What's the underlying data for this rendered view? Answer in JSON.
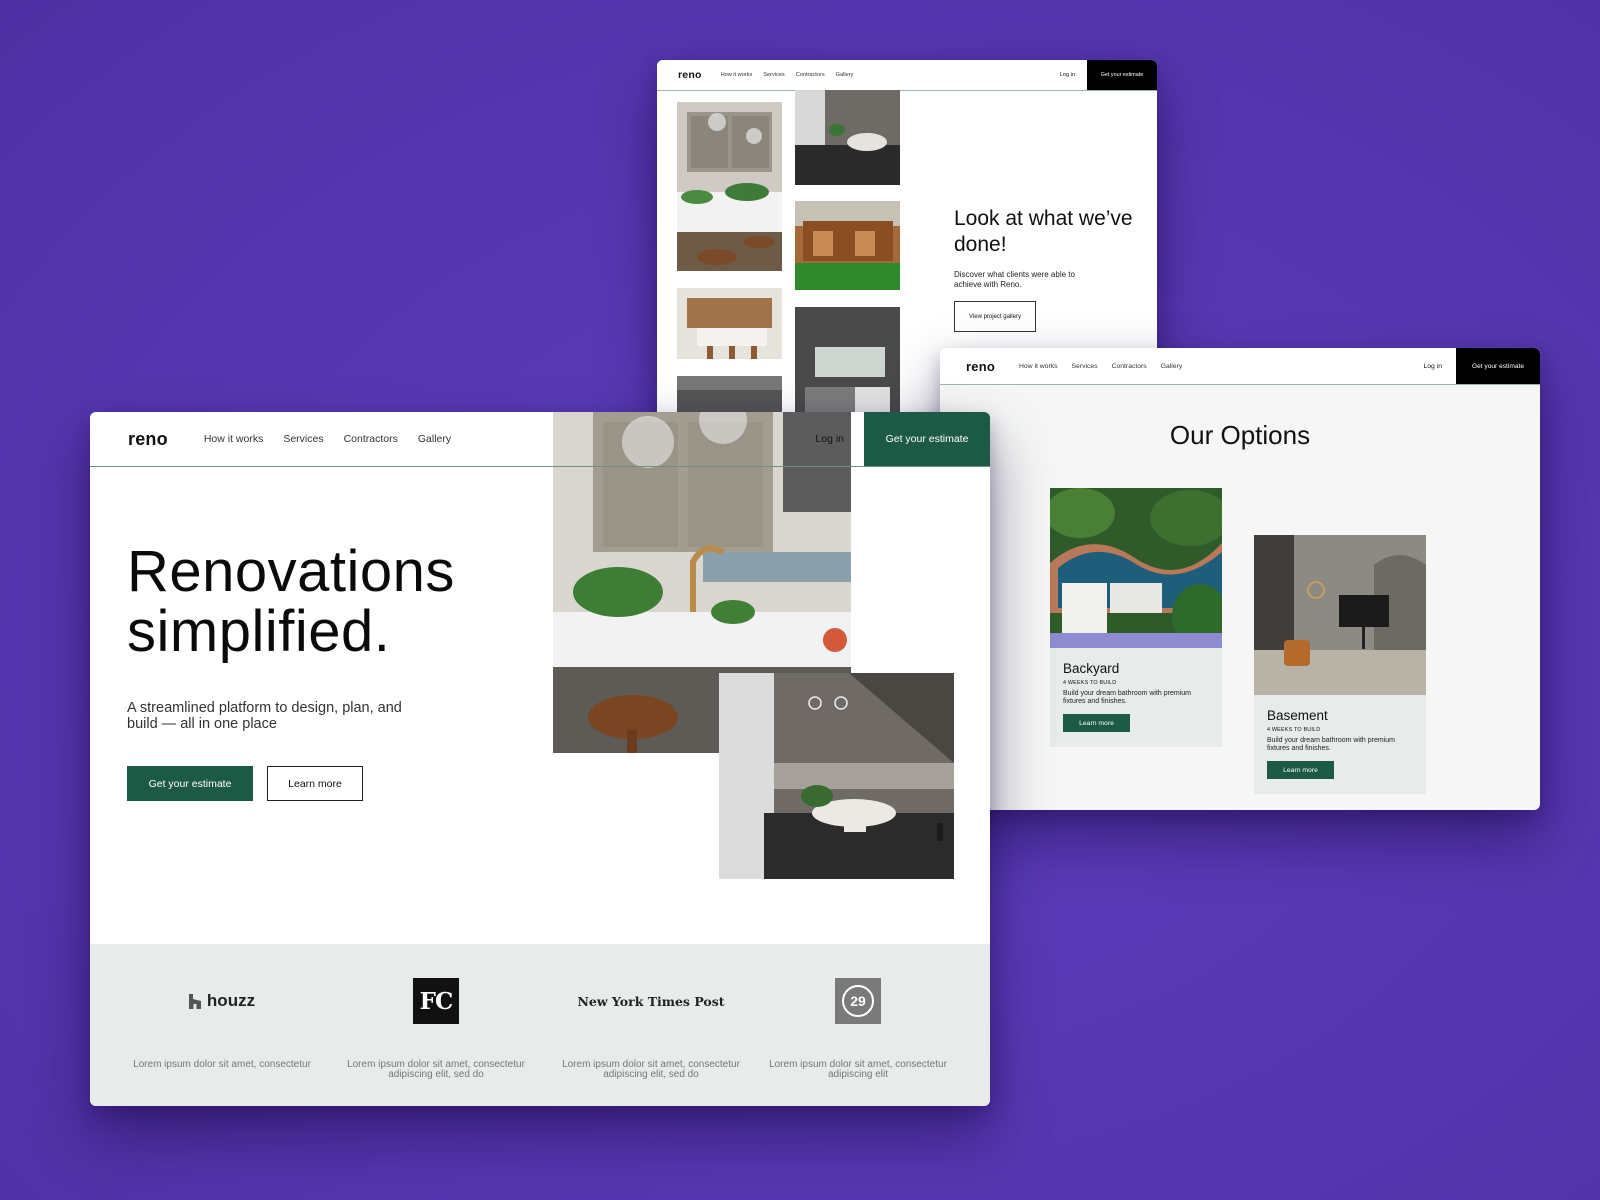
{
  "brand": {
    "logo": "reno",
    "accent_green": "#1c5a46",
    "black": "#000000",
    "backdrop_purple": "#5a3ab5"
  },
  "nav": {
    "links": [
      "How it works",
      "Services",
      "Contractors",
      "Gallery"
    ],
    "login": "Log in",
    "cta": "Get your estimate"
  },
  "gallery_page": {
    "heading": "Look at what we’ve done!",
    "subtext": "Discover what clients were able to achieve with Reno.",
    "button": "View project gallery"
  },
  "options_page": {
    "title": "Our Options",
    "cards": [
      {
        "name": "Backyard",
        "duration": "4 WEEKS TO BUILD",
        "description": "Build your dream bathroom with premium fixtures and finishes.",
        "button": "Learn more"
      },
      {
        "name": "Basement",
        "duration": "4 WEEKS TO BUILD",
        "description": "Build your dream bathroom with premium fixtures and finishes.",
        "button": "Learn more"
      }
    ]
  },
  "home_page": {
    "hero_title_line1": "Renovations",
    "hero_title_line2": "simplified.",
    "hero_subtitle": "A streamlined platform to design, plan, and build — all in one place",
    "primary_button": "Get your estimate",
    "secondary_button": "Learn more",
    "press": [
      {
        "logo": "houzz",
        "text": "Lorem ipsum dolor sit amet, consectetur"
      },
      {
        "logo": "FC",
        "text": "Lorem ipsum dolor sit amet, consectetur adipiscing elit, sed do"
      },
      {
        "logo": "New York Times Post",
        "text": "Lorem ipsum dolor sit amet, consectetur adipiscing elit, sed do"
      },
      {
        "logo": "29",
        "text": "Lorem ipsum dolor sit amet, consectetur adipiscing elit"
      }
    ]
  },
  "icons": {
    "houzz": "houzz-logo-icon",
    "fc": "fast-company-logo-icon",
    "nyt": "newspaper-logo-icon",
    "refinery29": "refinery29-logo-icon"
  }
}
